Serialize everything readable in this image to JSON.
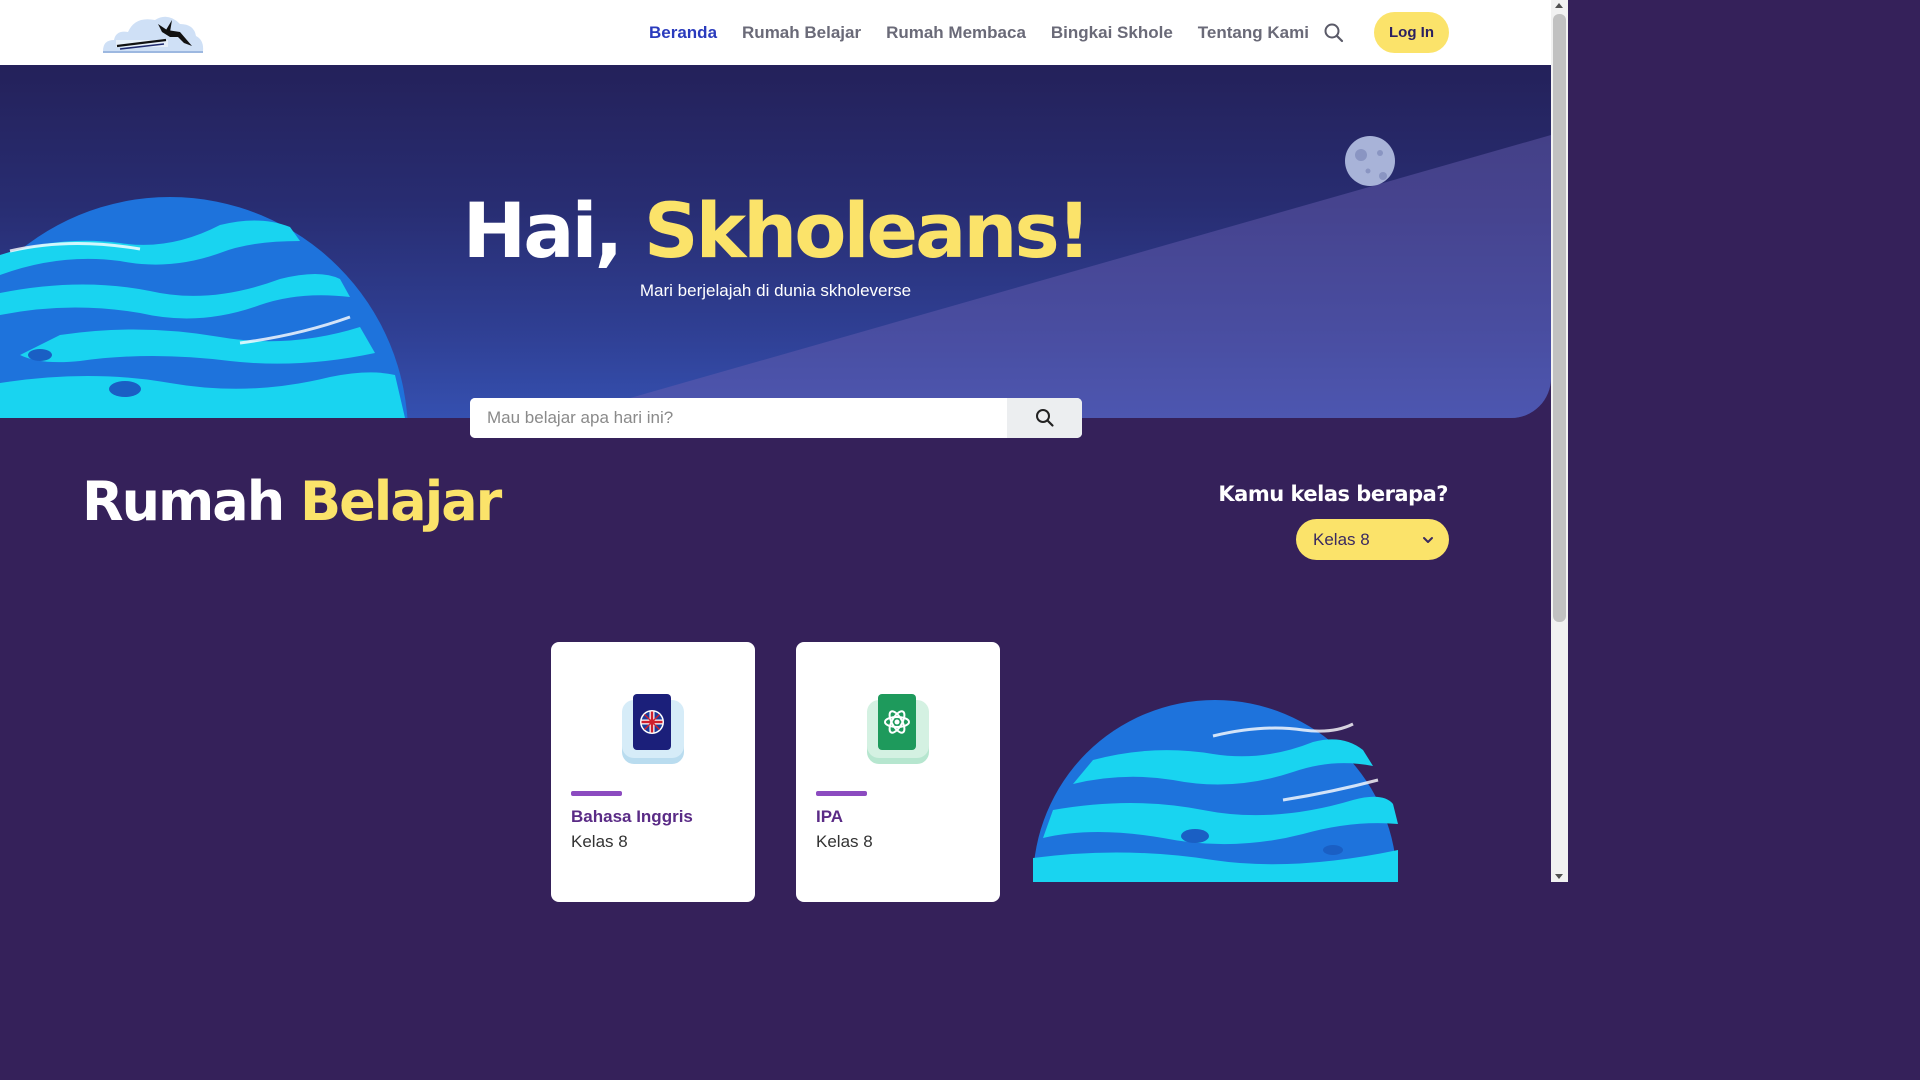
{
  "colors": {
    "brand_yellow": "#fbe36a",
    "nav_active": "#2a3bbd",
    "background": "#35215a",
    "card_accent": "#8c4bc0"
  },
  "nav": {
    "logo_icon": "skhole-logo-icon",
    "links": [
      {
        "label": "Beranda",
        "active": true
      },
      {
        "label": "Rumah Belajar",
        "active": false
      },
      {
        "label": "Rumah Membaca",
        "active": false
      },
      {
        "label": "Bingkai Skhole",
        "active": false
      },
      {
        "label": "Tentang Kami",
        "active": false
      }
    ],
    "search_icon": "search-icon",
    "login_label": "Log In"
  },
  "hero": {
    "greeting": "Hai,",
    "highlight": "Skholeans!",
    "subtitle": "Mari berjelajah di dunia skholeverse"
  },
  "search": {
    "placeholder": "Mau belajar apa hari ini?",
    "value": ""
  },
  "section": {
    "title_main": "Rumah",
    "title_highlight": "Belajar",
    "grade_prompt": "Kamu kelas berapa?",
    "grade_selected": "Kelas 8"
  },
  "cards": [
    {
      "title": "Bahasa Inggris",
      "subtitle": "Kelas 8",
      "icon": "uk-flag-book-icon"
    },
    {
      "title": "IPA",
      "subtitle": "Kelas 8",
      "icon": "science-atom-book-icon"
    }
  ]
}
